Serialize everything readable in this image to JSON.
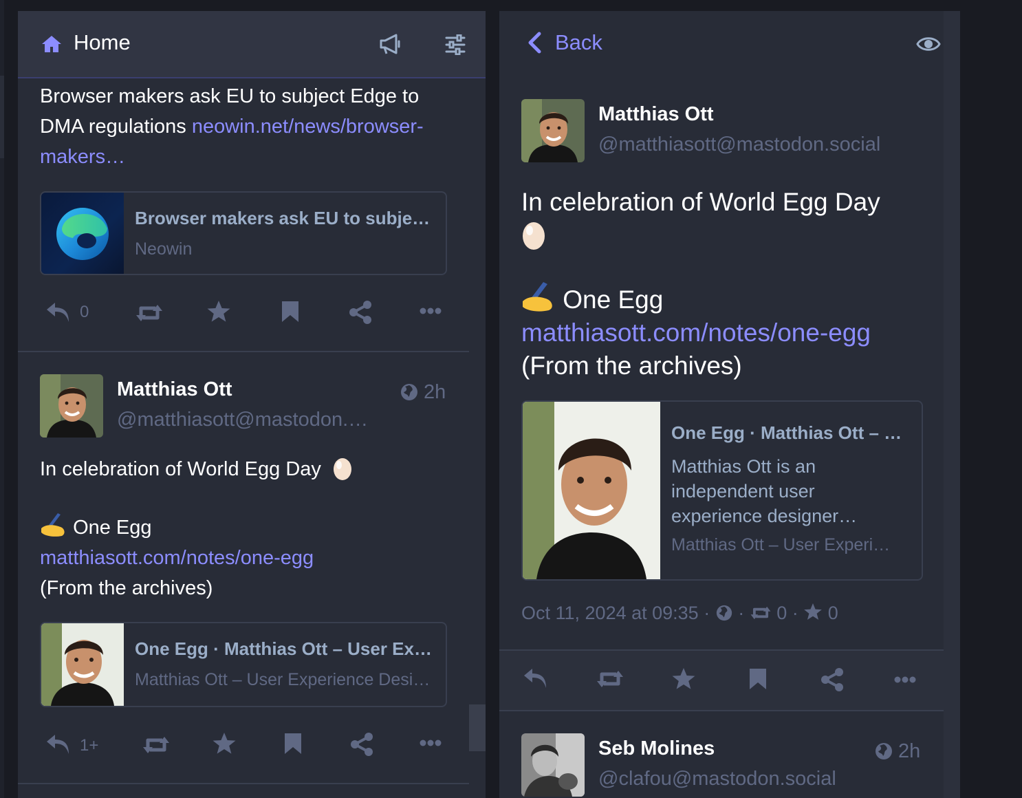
{
  "home_column": {
    "title": "Home",
    "top_post": {
      "text_part1": "Browser makers ask EU to subject Edge to",
      "text_part2": "DMA regulations ",
      "link_part1": "neowin.net/news/browser-",
      "link_part2": "makers…",
      "card": {
        "title": "Browser makers ask EU to subje…",
        "source": "Neowin"
      },
      "reply_count": "0"
    },
    "egg_post": {
      "author": "Matthias Ott",
      "handle": "@matthiasott@mastodon.…",
      "time": "2h",
      "line1": "In celebration of World Egg Day",
      "line2": "One Egg",
      "link": "matthiasott.com/notes/one-egg",
      "line3": "(From the archives)",
      "card": {
        "title": "One Egg · Matthias Ott – User Ex…",
        "source": "Matthias Ott – User Experience Desi…"
      },
      "reply_count": "1+"
    }
  },
  "detail_column": {
    "back_label": "Back",
    "author": "Matthias Ott",
    "handle": "@matthiasott@mastodon.social",
    "line1": "In celebration of World Egg Day",
    "line2": "One Egg",
    "link": "matthiasott.com/notes/one-egg",
    "line3": "(From the archives)",
    "card": {
      "title": "One Egg · Matthias Ott – …",
      "desc1": "Matthias Ott is an",
      "desc2": "independent user",
      "desc3": "experience designer…",
      "source": "Matthias Ott – User Experi…"
    },
    "meta": {
      "date": "Oct 11, 2024 at 09:35",
      "boosts": "0",
      "favourites": "0"
    },
    "next_post": {
      "author": "Seb Molines",
      "handle": "@clafou@mastodon.social",
      "time": "2h"
    }
  },
  "colors": {
    "background": "#191b22",
    "column": "#282c37",
    "header": "#313543",
    "link": "#8c8dff",
    "muted": "#606984",
    "secondary": "#9baec8"
  }
}
